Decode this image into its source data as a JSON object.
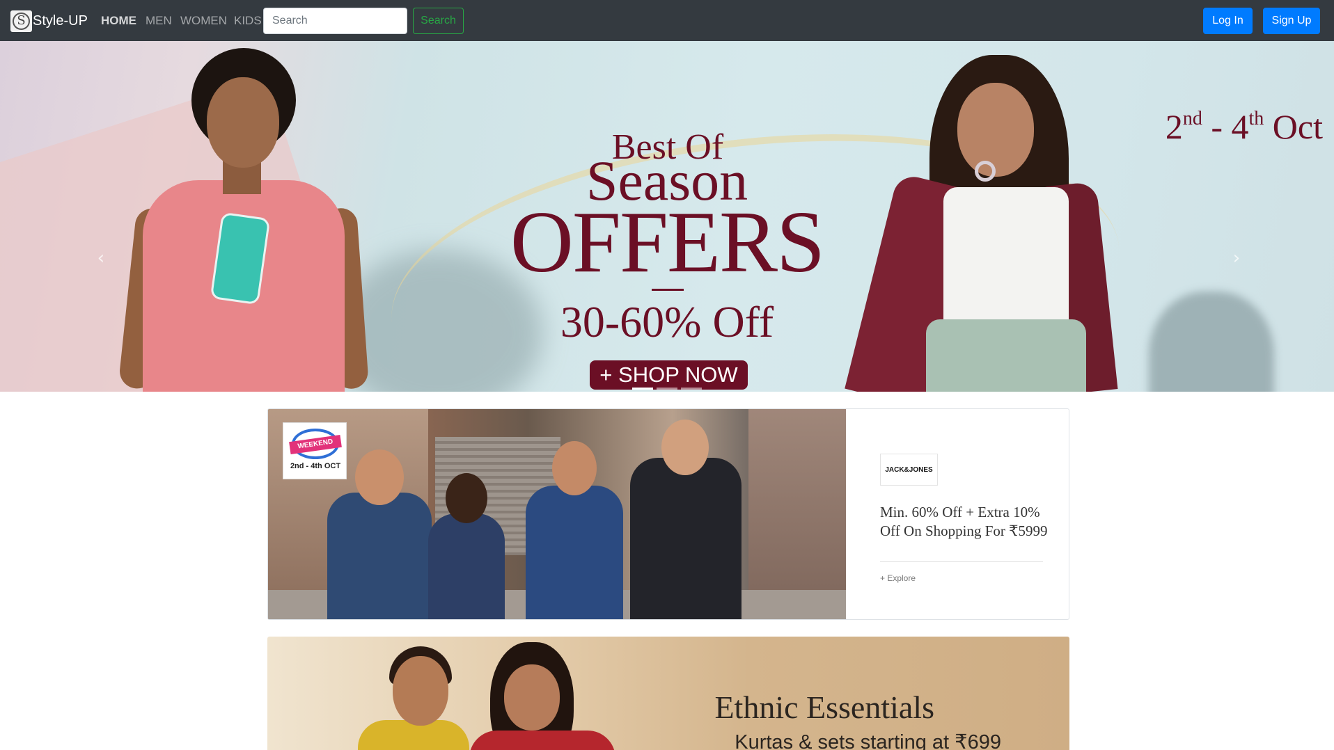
{
  "navbar": {
    "brand_logo_glyph": "S",
    "brand": "Style-UP",
    "links": [
      "HOME",
      "MEN",
      "WOMEN",
      "KIDS"
    ],
    "search_placeholder": "Search",
    "search_button": "Search",
    "login": "Log In",
    "signup": "Sign Up",
    "colors": {
      "background": "#343a40",
      "primary": "#007bff",
      "success": "#28a745"
    }
  },
  "hero": {
    "line1": "Best Of",
    "line2": "Season",
    "line3": "OFFERS",
    "discount": "30-60% Off",
    "cta": "+ SHOP NOW",
    "date_day1": "2",
    "date_sup1": "nd",
    "date_sep": " - ",
    "date_day2": "4",
    "date_sup2": "th",
    "date_month": " Oct",
    "prev_icon": "chevron-left-icon",
    "next_icon": "chevron-right-icon",
    "slide_count": 3,
    "active_slide": 1,
    "accent_color": "#6b0f25"
  },
  "promo": {
    "badge_text": "WEEKEND",
    "badge_date": "2nd - 4th OCT",
    "brand_name": "JACK&JONES",
    "offer": "Min. 60% Off + Extra 10% Off On Shopping For ₹5999",
    "explore": "+ Explore"
  },
  "ethnic": {
    "title": "Ethnic Essentials",
    "subtitle": "Kurtas & sets starting at ₹699"
  }
}
